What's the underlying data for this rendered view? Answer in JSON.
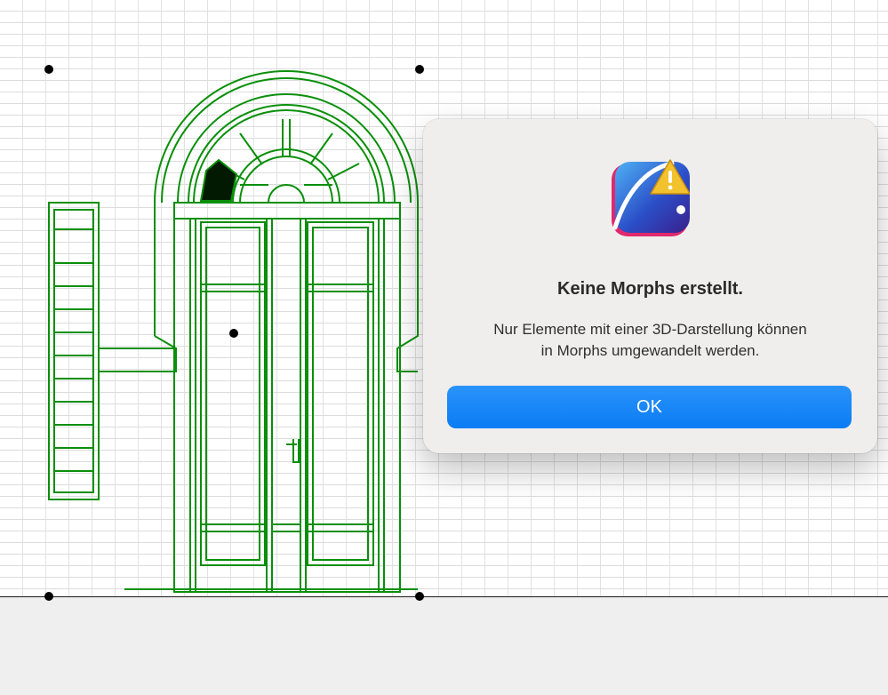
{
  "dialog": {
    "title": "Keine Morphs erstellt.",
    "message_line1": "Nur Elemente mit einer 3D-Darstellung können",
    "message_line2": "in Morphs umgewandelt werden.",
    "ok_label": "OK",
    "icon": "warning-icon"
  },
  "colors": {
    "drawing_stroke": "#0a8f0a",
    "button_blue": "#0a7cf3",
    "dialog_bg": "#efeeed",
    "warning_yellow": "#f2c12e"
  }
}
